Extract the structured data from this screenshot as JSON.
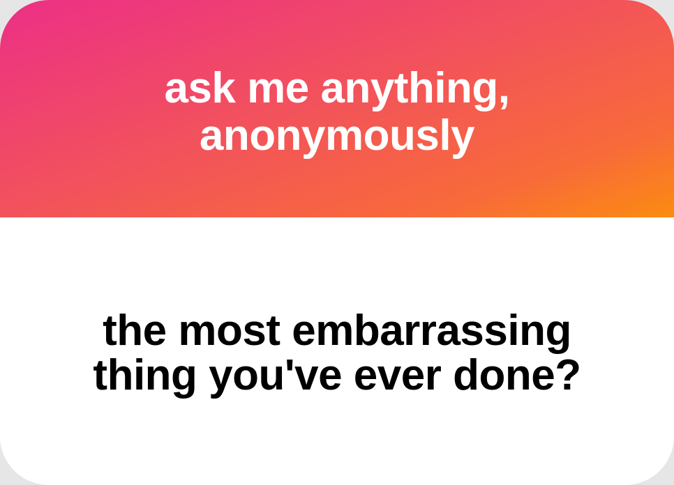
{
  "header": {
    "title_line1": "ask me anything,",
    "title_line2": "anonymously"
  },
  "question": {
    "line1": "the most embarrassing",
    "line2": "thing you've ever done?"
  },
  "colors": {
    "gradient_start": "#ec2f86",
    "gradient_end": "#fb8c10",
    "header_text": "#ffffff",
    "question_text": "#000000",
    "card_background": "#ffffff"
  }
}
